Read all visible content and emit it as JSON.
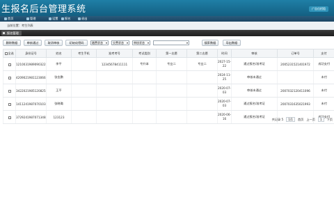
{
  "banner": {
    "title": "生报名后台管理系统",
    "tag": "广告位招租"
  },
  "menu": [
    {
      "label": "首页",
      "icon": "home-icon"
    },
    {
      "label": "管理",
      "icon": "manage-icon"
    },
    {
      "label": "设置",
      "icon": "settings-icon"
    },
    {
      "label": "报名",
      "icon": "signup-icon"
    },
    {
      "label": "退出",
      "icon": "logout-icon"
    }
  ],
  "breadcrumb": "当前位置：考生列表",
  "tab": {
    "label": "报名管理"
  },
  "toolbar": {
    "buttons": [
      "删除数据",
      "审核通过",
      "取消审核",
      "初始化密码"
    ],
    "filters": [
      "缴费状态",
      "交费状态",
      "审核状态"
    ],
    "search_label": "搜索数据",
    "export_label": "导出数据"
  },
  "table": {
    "columns": [
      "全选",
      "身份证号",
      "姓名",
      "考生手机",
      "准考考号",
      "考试类别",
      "第一志愿",
      "第二志愿",
      "时间",
      "审核",
      "订单号",
      "支付"
    ],
    "rows": [
      {
        "id": "121003198909032210",
        "name": "李平",
        "phone": "",
        "ticket": "12345678411111",
        "type": "专升本",
        "first": "专业二",
        "second": "专业二",
        "time": "2027-15-22",
        "audit": "通过报名/准考证",
        "audit_kind": "blue",
        "order": "2005231521401972",
        "pay": "成功支付",
        "pay_kind": "red"
      },
      {
        "id": "420902198112306615",
        "name": "张金鹏",
        "phone": "",
        "ticket": "",
        "type": "",
        "first": "",
        "second": "",
        "time": "2024-11-25",
        "audit": "审核未通过",
        "audit_kind": "red",
        "order": "",
        "pay": "未付",
        "pay_kind": "red"
      },
      {
        "id": "342202198512082511",
        "name": "王平",
        "phone": "",
        "ticket": "",
        "type": "",
        "first": "",
        "second": "",
        "time": "2020-07-03",
        "audit": "审核未通过",
        "audit_kind": "red",
        "order": "2007032120411096",
        "pay": "未付",
        "pay_kind": "red"
      },
      {
        "id": "141124198707010372",
        "name": "张晓璐",
        "phone": "",
        "ticket": "",
        "type": "",
        "first": "",
        "second": "",
        "time": "2020-07-03",
        "audit": "通过报名/准考证",
        "audit_kind": "blue",
        "order": "2007031635021993",
        "pay": "未付",
        "pay_kind": "red"
      },
      {
        "id": "372924198707134831",
        "name": "123123",
        "phone": "",
        "ticket": "",
        "type": "",
        "first": "",
        "second": "",
        "time": "2020-06-16",
        "audit": "通过报名/准考证",
        "audit_kind": "blue",
        "order": "",
        "pay": "成功支付",
        "pay_kind": "red"
      }
    ]
  },
  "pager": {
    "total": "共记录 5",
    "page": "1/1",
    "first": "首页",
    "prev": "上一页",
    "page_num": "1",
    "next": "下页"
  }
}
